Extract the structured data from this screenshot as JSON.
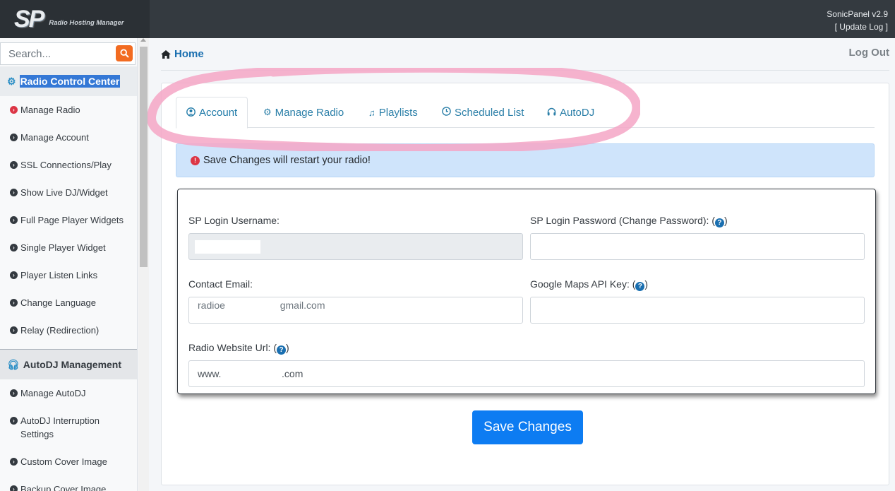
{
  "header": {
    "logo": "SP",
    "logo_subtitle": "Radio Hosting Manager",
    "version": "SonicPanel v2.9",
    "update_log": "[ Update Log ]"
  },
  "sidebar": {
    "search_placeholder": "Search...",
    "section1": {
      "icon": "gear-icon",
      "label": "Radio Control Center"
    },
    "items1": [
      {
        "label": "Manage Radio"
      },
      {
        "label": "Manage Account"
      },
      {
        "label": "SSL Connections/Play"
      },
      {
        "label": "Show Live DJ/Widget"
      },
      {
        "label": "Full Page Player Widgets"
      },
      {
        "label": "Single Player Widget"
      },
      {
        "label": "Player Listen Links"
      },
      {
        "label": "Change Language"
      },
      {
        "label": "Relay (Redirection)"
      }
    ],
    "section2": {
      "icon": "headphones-icon",
      "label": "AutoDJ Management"
    },
    "items2": [
      {
        "label": "Manage AutoDJ"
      },
      {
        "label": "AutoDJ Interruption Settings"
      },
      {
        "label": "Custom Cover Image"
      },
      {
        "label": "Backup Cover Image"
      }
    ]
  },
  "main": {
    "breadcrumb": "Home",
    "logout": "Log Out",
    "tabs": [
      {
        "label": "Account",
        "icon": "user-circle-icon"
      },
      {
        "label": "Manage Radio",
        "icon": "gear-icon"
      },
      {
        "label": "Playlists",
        "icon": "music-icon"
      },
      {
        "label": "Scheduled List",
        "icon": "clock-icon"
      },
      {
        "label": "AutoDJ",
        "icon": "headphones-icon"
      }
    ],
    "alert": "Save Changes will restart your radio!",
    "form": {
      "username_label": "SP Login Username:",
      "username_value": "",
      "password_label": "SP Login Password (Change Password): (",
      "password_label_close": ")",
      "password_value": "",
      "email_label": "Contact Email:",
      "email_value": "radioe                    gmail.com",
      "maps_label": "Google Maps API Key: (",
      "maps_label_close": ")",
      "maps_value": "",
      "website_label": "Radio Website Url: (",
      "website_label_close": ")",
      "website_value": "www.                      .com",
      "help_glyph": "?"
    },
    "save_button": "Save Changes"
  },
  "colors": {
    "accent": "#0d7cf2",
    "tab_text": "#2b7fa8",
    "alert_bg": "#cfe4fb",
    "annotation": "#f4a6c6"
  }
}
